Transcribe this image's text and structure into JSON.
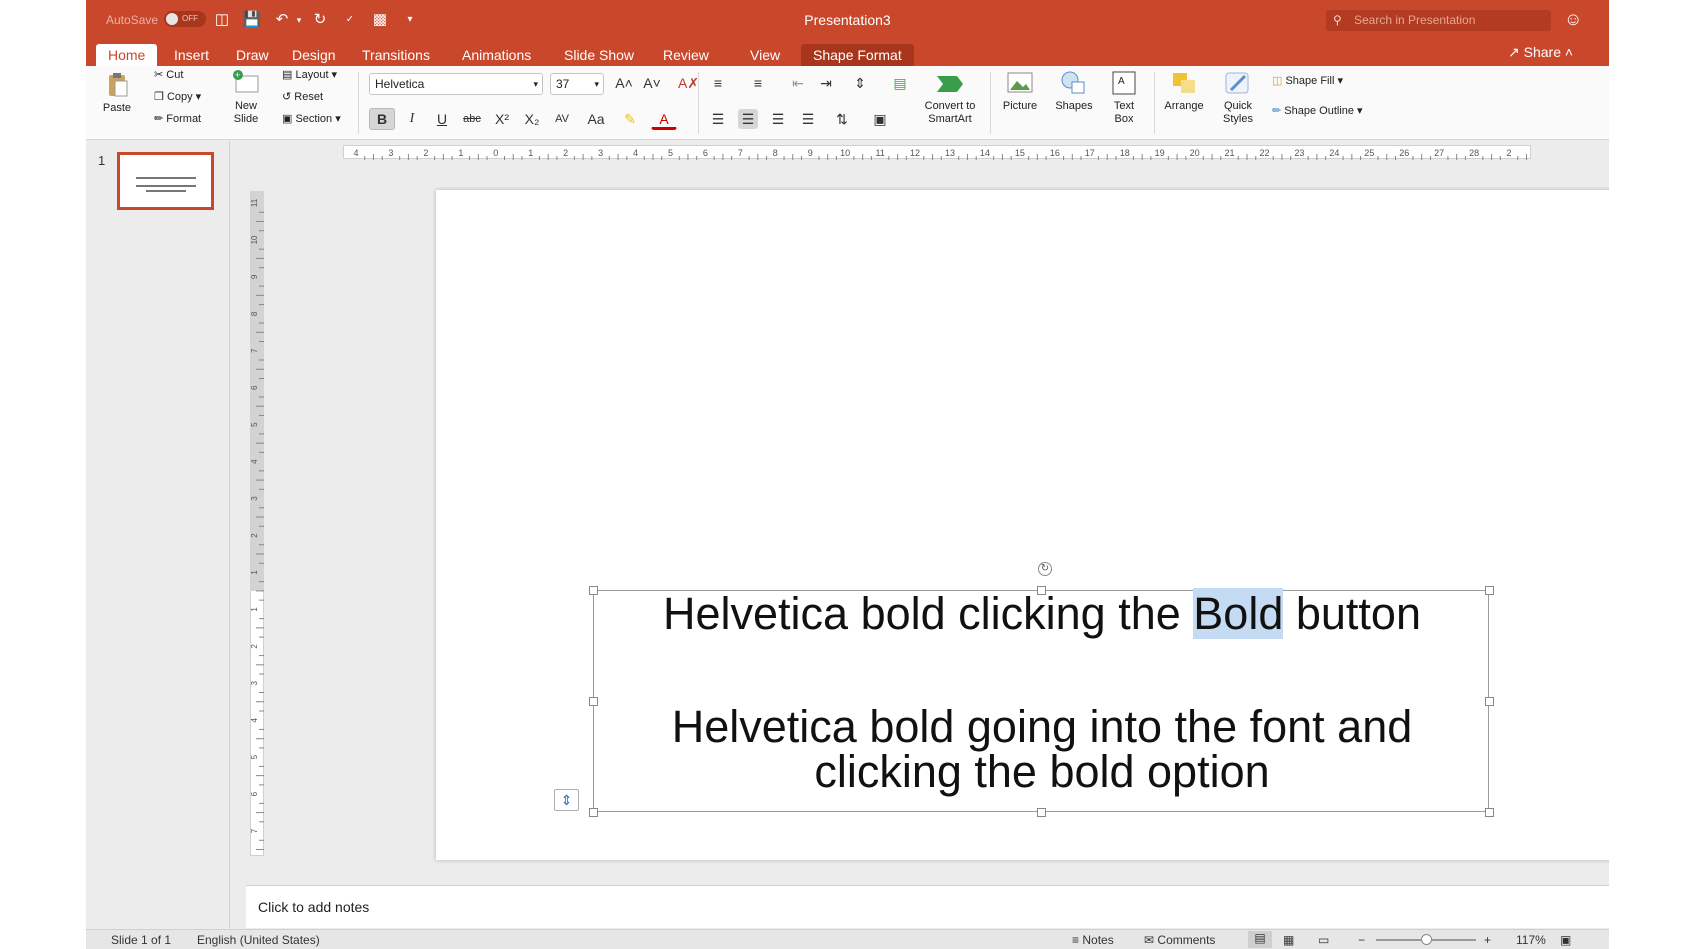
{
  "titlebar": {
    "autosave_label": "AutoSave",
    "autosave_state": "OFF",
    "title": "Presentation3",
    "search_placeholder": "Search in Presentation"
  },
  "tabs": [
    {
      "label": "Home"
    },
    {
      "label": "Insert"
    },
    {
      "label": "Draw"
    },
    {
      "label": "Design"
    },
    {
      "label": "Transitions"
    },
    {
      "label": "Animations"
    },
    {
      "label": "Slide Show"
    },
    {
      "label": "Review"
    },
    {
      "label": "View"
    },
    {
      "label": "Shape Format"
    }
  ],
  "share_label": "Share",
  "ribbon": {
    "paste": "Paste",
    "cut": "Cut",
    "copy": "Copy",
    "format": "Format",
    "new_slide": [
      "New",
      "Slide"
    ],
    "layout": "Layout",
    "reset": "Reset",
    "section": "Section",
    "font_name": "Helvetica",
    "font_size": "37",
    "convert_smartart": [
      "Convert to",
      "SmartArt"
    ],
    "picture": "Picture",
    "shapes": "Shapes",
    "text_box": [
      "Text",
      "Box"
    ],
    "arrange": "Arrange",
    "quick_styles": [
      "Quick",
      "Styles"
    ],
    "shape_fill": "Shape Fill",
    "shape_outline": "Shape Outline"
  },
  "thumbnail": {
    "number": "1"
  },
  "ruler": {
    "h_labels": [
      "4",
      "3",
      "2",
      "1",
      "0",
      "1",
      "2",
      "3",
      "4",
      "5",
      "6",
      "7",
      "8",
      "9",
      "10",
      "11",
      "12",
      "13",
      "14",
      "15",
      "16",
      "17",
      "18",
      "19",
      "20",
      "21",
      "22",
      "23",
      "24",
      "25",
      "26",
      "27",
      "28",
      "2"
    ],
    "v_labels": [
      "11",
      "10",
      "9",
      "8",
      "7",
      "6",
      "5",
      "4",
      "3",
      "2",
      "1",
      "1",
      "2",
      "3",
      "4",
      "5",
      "6",
      "7"
    ]
  },
  "slide": {
    "line1_before": "Helvetica bold clicking the ",
    "line1_selected": "Bold",
    "line1_after": " button",
    "line2": "Helvetica bold going into the font and",
    "line3": "clicking the bold option"
  },
  "notes_placeholder": "Click to add notes",
  "status": {
    "slide": "Slide 1 of 1",
    "language": "English (United States)",
    "notes": "Notes",
    "comments": "Comments",
    "zoom": "117%"
  },
  "colors": {
    "accent": "#c9472b",
    "selection": "#c5daf3"
  }
}
